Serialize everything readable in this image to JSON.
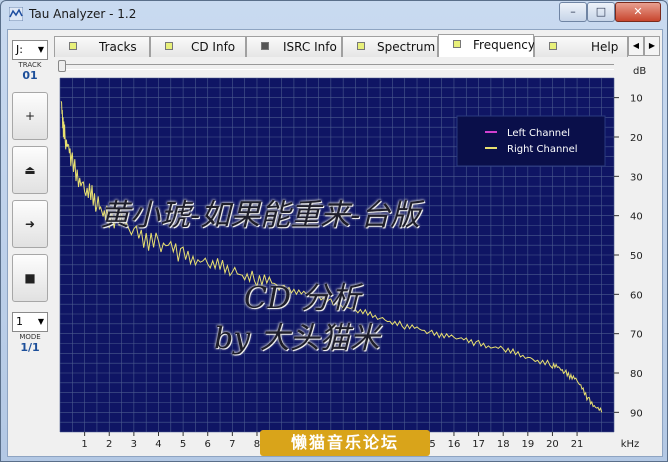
{
  "window": {
    "title": "Tau Analyzer - 1.2"
  },
  "title_buttons": {
    "minimize": "–",
    "maximize": "□",
    "close": "✕"
  },
  "left_panel": {
    "drive_value": "J:",
    "track_label": "TRACK",
    "track_value": "01",
    "buttons": [
      "+",
      "⏏",
      "➜",
      "■"
    ],
    "mode_value": "1",
    "mode_label": "MODE",
    "mode_display": "1/1"
  },
  "tabs": [
    {
      "label": "Tracks",
      "marker": "yellow"
    },
    {
      "label": "CD Info",
      "marker": "yellow"
    },
    {
      "label": "ISRC Info",
      "marker": "dark"
    },
    {
      "label": "Spectrum",
      "marker": "yellow"
    },
    {
      "label": "Frequency",
      "marker": "yellow",
      "active": true
    },
    {
      "label": "Help",
      "marker": "yellow"
    }
  ],
  "tab_nav": {
    "left": "◀",
    "right": "▶"
  },
  "colors": {
    "plot_bg": "#0f1564",
    "grid": "#4a5a8e",
    "left_channel": "#d040d0",
    "right_channel": "#e8e070",
    "legend_bg": "#0a0f4a"
  },
  "watermark": {
    "line1": "黄小琥-如果能重来-台版",
    "line2": "CD 分析",
    "line3": "by 大头猫米",
    "forum": "懒猫音乐论坛"
  },
  "chart_data": {
    "type": "line",
    "ylabel": "dB",
    "xlabel": "kHz",
    "x_ticks": [
      1,
      2,
      3,
      4,
      5,
      6,
      7,
      8,
      9,
      10,
      11,
      12,
      13,
      14,
      15,
      16,
      17,
      18,
      19,
      20,
      21
    ],
    "y_ticks": [
      -10,
      -20,
      -30,
      -40,
      -50,
      -60,
      -70,
      -80,
      -90
    ],
    "y_tick_labels": [
      "10",
      "20",
      "30",
      "40",
      "50",
      "60",
      "70",
      "80",
      "90"
    ],
    "xlim": [
      0,
      22.5
    ],
    "ylim": [
      -5,
      -95
    ],
    "grid": true,
    "legend_position": "top-right",
    "series": [
      {
        "name": "Left Channel",
        "x": [],
        "y": []
      },
      {
        "name": "Right Channel",
        "x": [
          0.05,
          0.2,
          0.5,
          1,
          1.5,
          2,
          3,
          4,
          5,
          6,
          7,
          8,
          9,
          10,
          11,
          12,
          13,
          14,
          15,
          16,
          17,
          18,
          19,
          20,
          20.5,
          21,
          21.5,
          22
        ],
        "y": [
          -12,
          -20,
          -27,
          -33,
          -37,
          -40,
          -44,
          -47,
          -50,
          -52,
          -54,
          -56,
          -58,
          -60,
          -62,
          -64,
          -66,
          -68,
          -69.5,
          -71,
          -72.5,
          -74,
          -76,
          -78,
          -79.5,
          -82,
          -87,
          -90
        ]
      }
    ]
  }
}
